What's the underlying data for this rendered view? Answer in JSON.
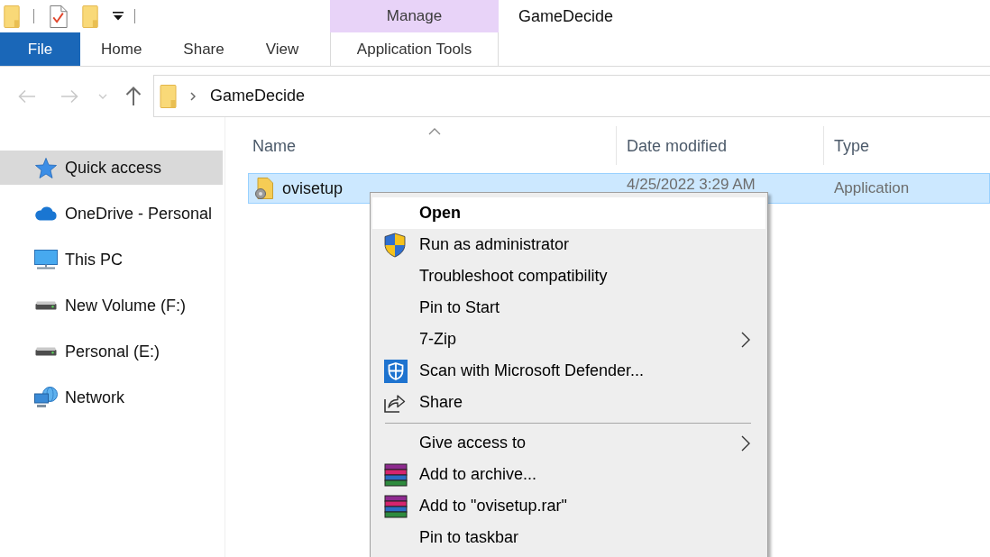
{
  "window": {
    "title": "GameDecide"
  },
  "ribbon": {
    "contextual_group": "Manage",
    "tabs": [
      {
        "label": "File",
        "kind": "file",
        "selected": false
      },
      {
        "label": "Home",
        "kind": "standard",
        "selected": false
      },
      {
        "label": "Share",
        "kind": "standard",
        "selected": false
      },
      {
        "label": "View",
        "kind": "standard",
        "selected": false
      },
      {
        "label": "Application Tools",
        "kind": "contextual",
        "selected": false
      }
    ]
  },
  "navigation": {
    "back": {
      "disabled": true
    },
    "forward": {
      "disabled": true
    },
    "recent": {
      "disabled": true
    },
    "up": {
      "disabled": false
    },
    "path": [
      "GameDecide"
    ]
  },
  "sidebar": {
    "items": [
      {
        "label": "Quick access",
        "kind": "star",
        "selected": true
      },
      {
        "label": "OneDrive - Personal",
        "kind": "cloud",
        "selected": false
      },
      {
        "label": "This PC",
        "kind": "computer",
        "selected": false
      },
      {
        "label": "New Volume (F:)",
        "kind": "drive",
        "selected": false
      },
      {
        "label": "Personal (E:)",
        "kind": "drive",
        "selected": false
      },
      {
        "label": "Network",
        "kind": "network",
        "selected": false
      }
    ]
  },
  "file_list": {
    "columns": [
      {
        "label": "Name",
        "sorted": true
      },
      {
        "label": "Date modified",
        "sorted": false
      },
      {
        "label": "Type",
        "sorted": false
      }
    ],
    "rows": [
      {
        "name": "ovisetup",
        "date_modified": "4/25/2022 3:29 AM",
        "type": "Application",
        "selected": true
      }
    ]
  },
  "context_menu": {
    "items": [
      {
        "kind": "plain",
        "label": "Open",
        "default": true,
        "highlighted": true
      },
      {
        "kind": "shield",
        "label": "Run as administrator",
        "default": false,
        "highlighted": false
      },
      {
        "kind": "plain",
        "label": "Troubleshoot compatibility",
        "default": false,
        "highlighted": false
      },
      {
        "kind": "plain",
        "label": "Pin to Start",
        "default": false,
        "highlighted": false
      },
      {
        "kind": "submenu",
        "label": "7-Zip",
        "default": false,
        "highlighted": false
      },
      {
        "kind": "scan",
        "label": "Scan with Microsoft Defender...",
        "default": false,
        "highlighted": false
      },
      {
        "kind": "share",
        "label": "Share",
        "default": false,
        "highlighted": false
      },
      {
        "kind": "separator"
      },
      {
        "kind": "submenu",
        "label": "Give access to",
        "default": false,
        "highlighted": false
      },
      {
        "kind": "archive",
        "label": "Add to archive...",
        "default": false,
        "highlighted": false
      },
      {
        "kind": "archive",
        "label": "Add to \"ovisetup.rar\"",
        "default": false,
        "highlighted": false
      },
      {
        "kind": "plain",
        "label": "Pin to taskbar",
        "default": false,
        "highlighted": false
      }
    ]
  }
}
